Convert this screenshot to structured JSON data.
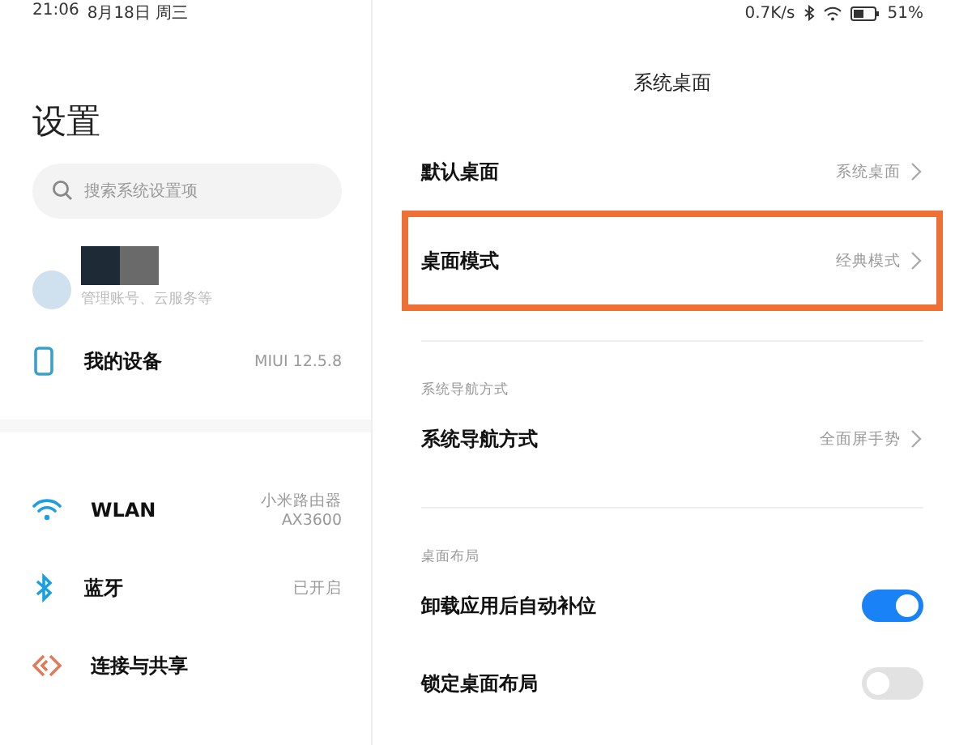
{
  "status_bar": {
    "time": "21:06",
    "date": "8月18日 周三",
    "speed": "0.7K/s",
    "battery": "51%"
  },
  "sidebar": {
    "title": "设置",
    "search": {
      "placeholder": "搜索系统设置项"
    },
    "account": {
      "subtitle": "管理账号、云服务等"
    },
    "groups": [
      [
        {
          "label": "我的设备",
          "value": "MIUI 12.5.8"
        }
      ],
      [
        {
          "label": "WLAN",
          "value": "小米路由器\nAX3600"
        },
        {
          "label": "蓝牙",
          "value": "已开启"
        },
        {
          "label": "连接与共享"
        }
      ]
    ]
  },
  "panel": {
    "title": "系统桌面",
    "sections": [
      {
        "items": [
          {
            "kind": "link",
            "label": "默认桌面",
            "value": "系统桌面",
            "highlighted": false
          },
          {
            "kind": "link",
            "label": "桌面模式",
            "value": "经典模式",
            "highlighted": true
          }
        ]
      },
      {
        "header": "系统导航方式",
        "items": [
          {
            "kind": "link",
            "label": "系统导航方式",
            "value": "全面屏手势",
            "highlighted": false
          }
        ]
      },
      {
        "header": "桌面布局",
        "items": [
          {
            "kind": "toggle",
            "label": "卸载应用后自动补位",
            "on": true
          },
          {
            "kind": "toggle",
            "label": "锁定桌面布局",
            "on": false
          }
        ]
      }
    ]
  }
}
